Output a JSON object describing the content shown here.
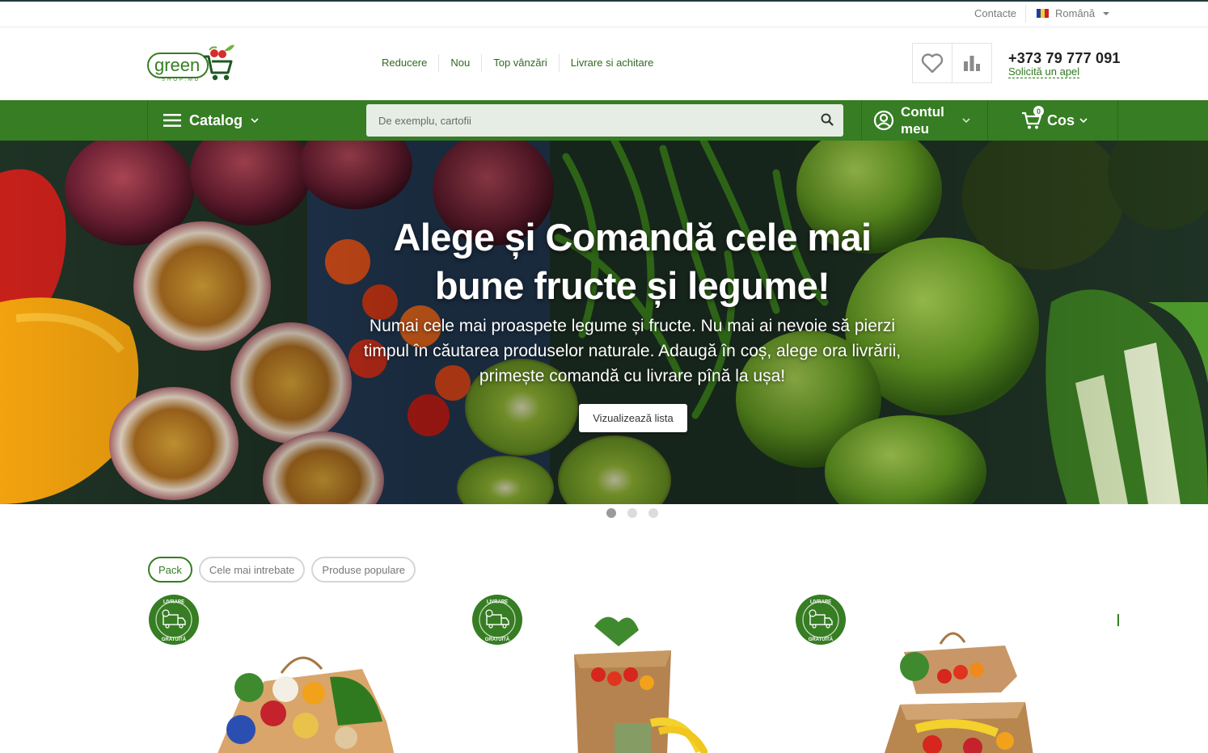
{
  "topbar": {
    "contacts": "Contacte",
    "language": "Română"
  },
  "header": {
    "logo_text": "green",
    "logo_sub": "SHOP.MD",
    "menu": [
      {
        "label": "Reducere"
      },
      {
        "label": "Nou"
      },
      {
        "label": "Top vânzări"
      },
      {
        "label": "Livrare si achitare"
      }
    ],
    "phone": "+373 79 777 091",
    "callback": "Solicită un apel"
  },
  "nav": {
    "catalog": "Catalog",
    "search_placeholder": "De exemplu, cartofii",
    "account_line1": "Contul",
    "account_line2": "meu",
    "cart_count": "0",
    "cart_label": "Cos"
  },
  "hero": {
    "title_line1": "Alege și Comandă cele mai",
    "title_line2": "bune fructe și legume!",
    "text_line1": "Numai cele mai proaspete legume și fructe. Nu mai ai nevoie să pierzi",
    "text_line2": "timpul în căutarea produselor naturale. Adaugă în coș, alege ora livrării,",
    "text_line3": "primește comandă cu livrare pînă la ușa!",
    "button": "Vizualizează lista",
    "slides": 3,
    "active_slide": 1
  },
  "tabs": [
    {
      "label": "Pack",
      "active": true
    },
    {
      "label": "Cele mai intrebate",
      "active": false
    },
    {
      "label": "Produse populare",
      "active": false
    }
  ],
  "badge": {
    "top_text": "LIVRARE",
    "bottom_text": "GRATUITĂ"
  },
  "colors": {
    "brand_green": "#367d23",
    "link_green": "#2f6b1f",
    "search_bg": "#e6ede4"
  }
}
